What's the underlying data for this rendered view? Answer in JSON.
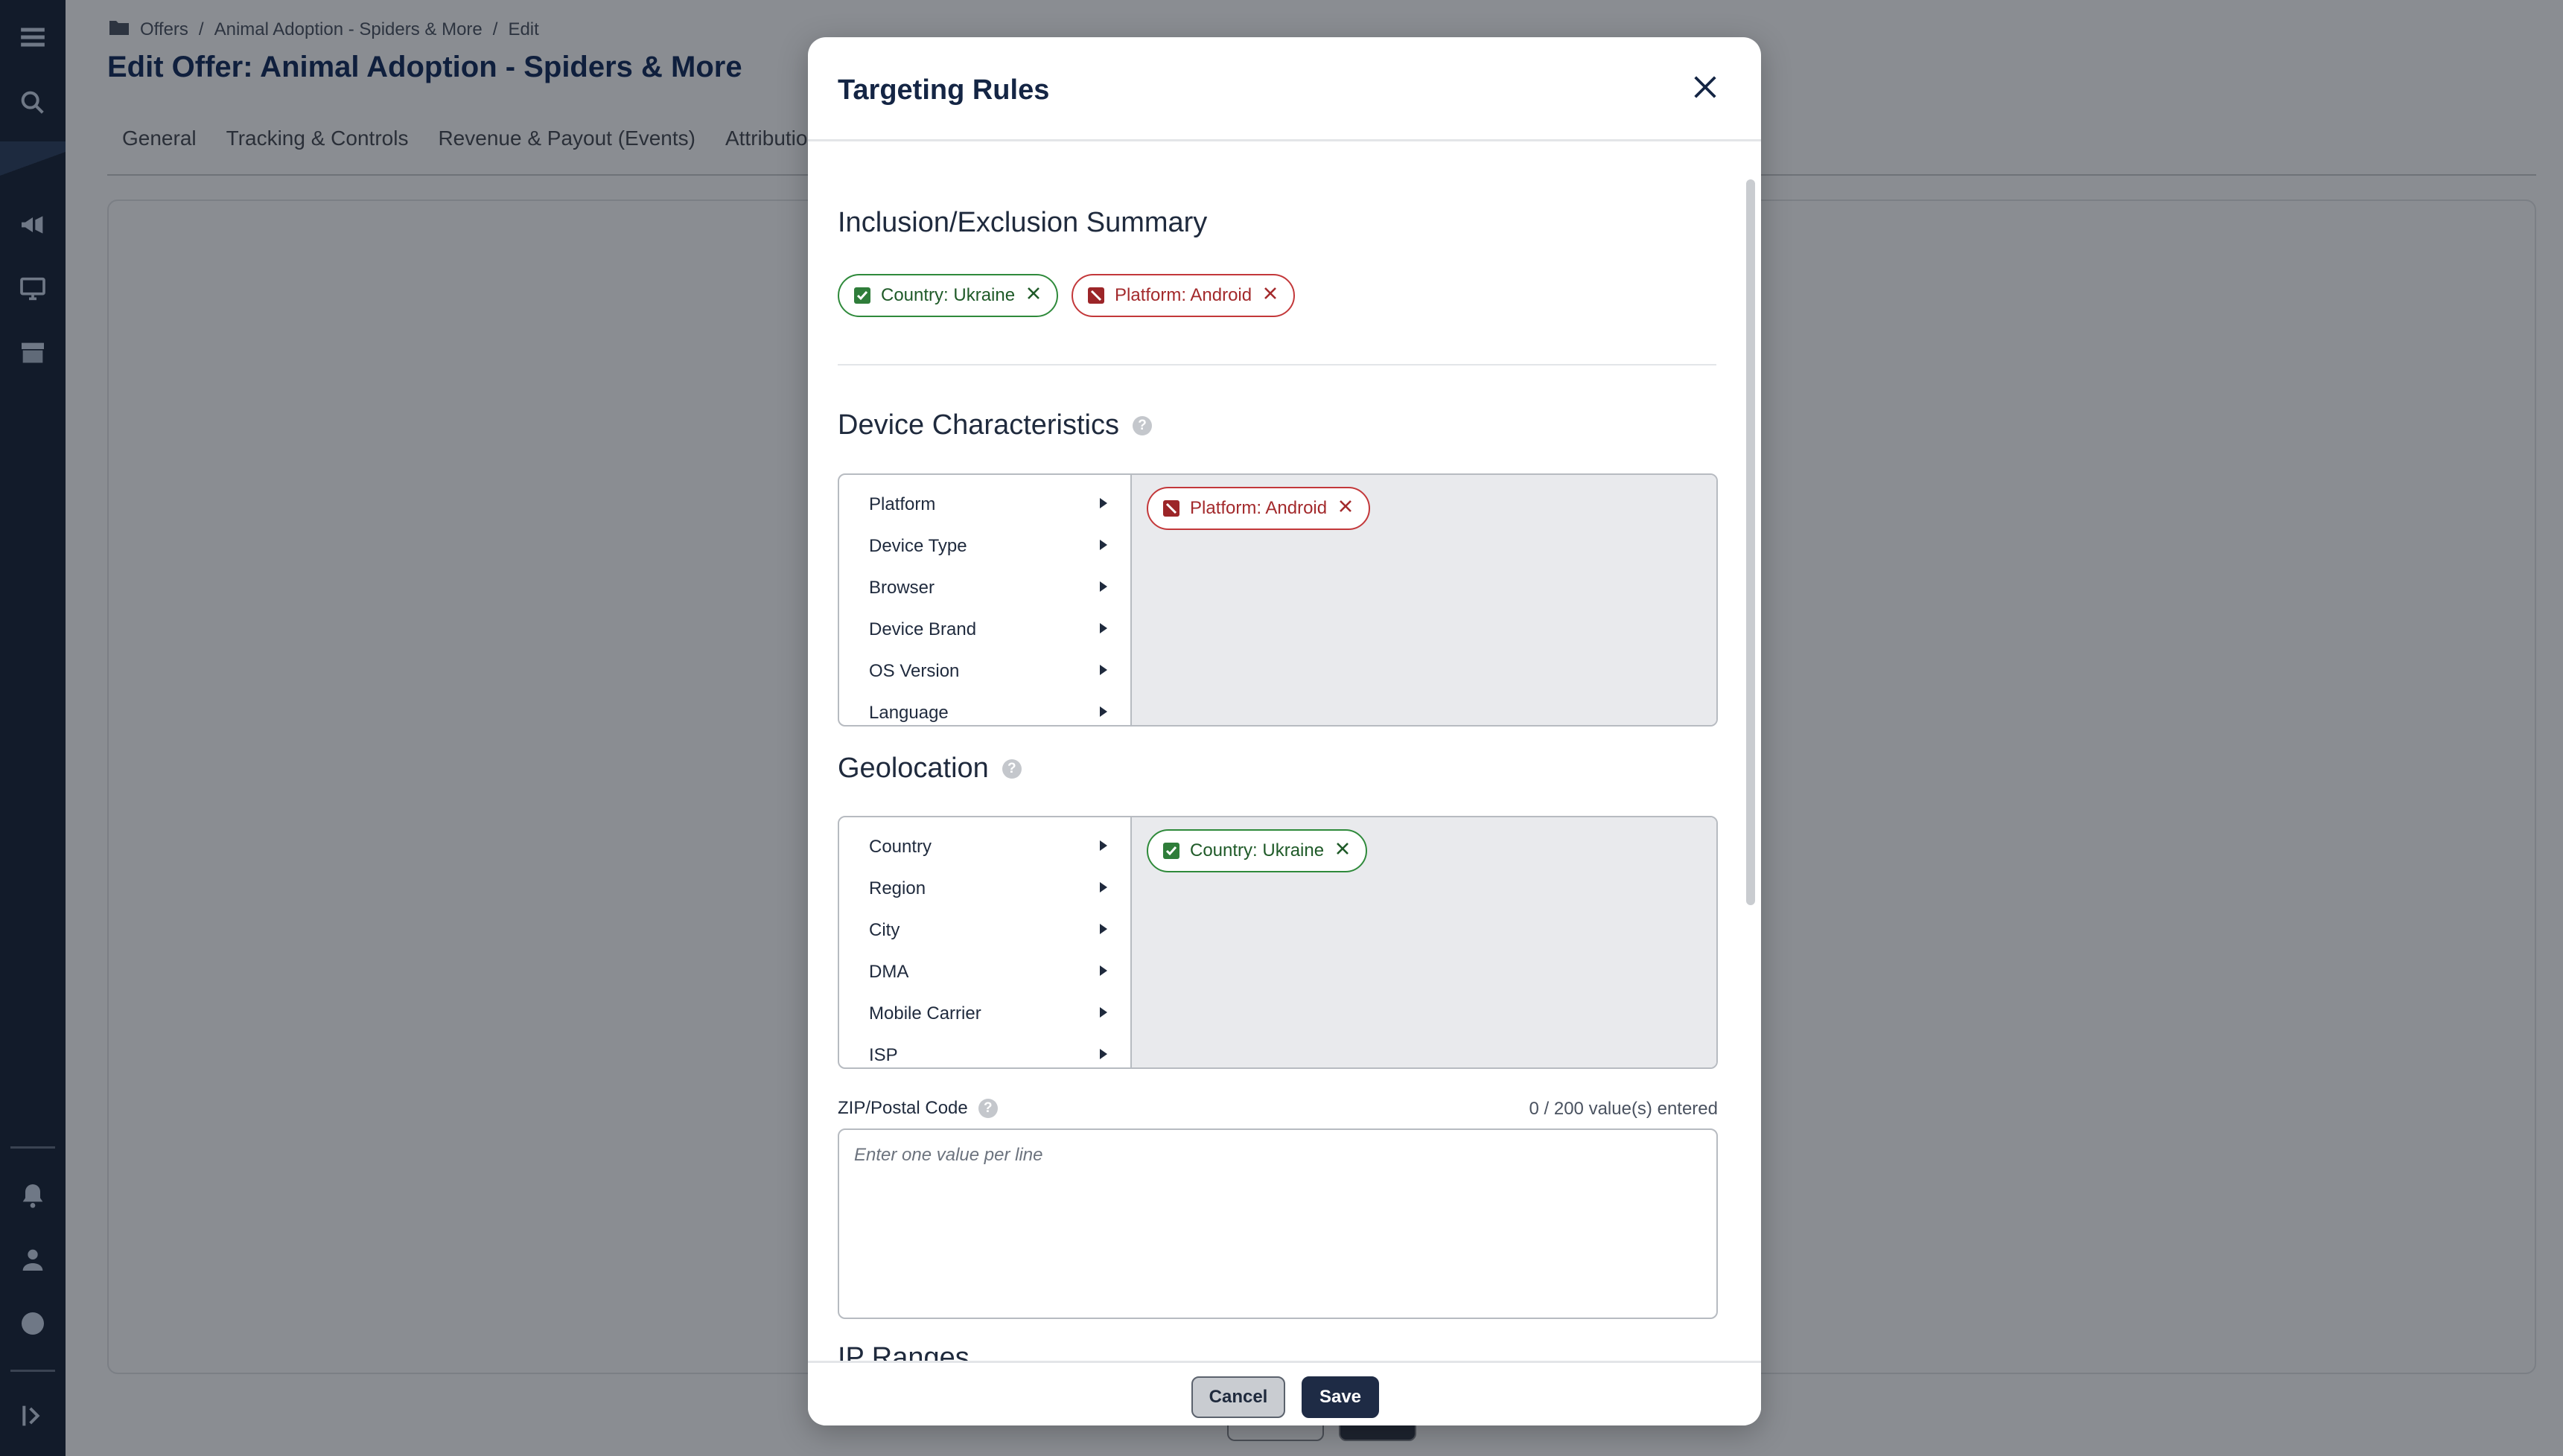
{
  "rail": {
    "icons": [
      "menu-icon",
      "search-icon",
      "megaphone-icon",
      "monitor-icon",
      "storefront-icon",
      "bell-icon",
      "user-icon",
      "help-icon",
      "expand-icon"
    ]
  },
  "breadcrumb": {
    "items": [
      "Offers",
      "Animal Adoption - Spiders & More",
      "Edit"
    ],
    "separator": "/"
  },
  "page": {
    "title": "Edit Offer: Animal Adoption - Spiders & More",
    "tabs": [
      "General",
      "Tracking & Controls",
      "Revenue & Payout (Events)",
      "Attribution"
    ]
  },
  "modal": {
    "title": "Targeting Rules",
    "summary": {
      "title": "Inclusion/Exclusion Summary",
      "chips": [
        {
          "label": "Country: Ukraine",
          "type": "include"
        },
        {
          "label": "Platform: Android",
          "type": "exclude"
        }
      ]
    },
    "device": {
      "title": "Device Characteristics",
      "items": [
        "Platform",
        "Device Type",
        "Browser",
        "Device Brand",
        "OS Version",
        "Language"
      ],
      "selected": [
        {
          "label": "Platform: Android",
          "type": "exclude"
        }
      ]
    },
    "geo": {
      "title": "Geolocation",
      "items": [
        "Country",
        "Region",
        "City",
        "DMA",
        "Mobile Carrier",
        "ISP"
      ],
      "selected": [
        {
          "label": "Country: Ukraine",
          "type": "include"
        }
      ]
    },
    "zip": {
      "label": "ZIP/Postal Code",
      "count": "0 / 200 value(s) entered",
      "placeholder": "Enter one value per line",
      "value": ""
    },
    "next_section": "IP Ranges",
    "footer": {
      "cancel": "Cancel",
      "save": "Save"
    }
  },
  "colors": {
    "include": "#2f8a3b",
    "exclude": "#c3383a",
    "primary": "#1e2b45",
    "rail": "#121b2a"
  }
}
